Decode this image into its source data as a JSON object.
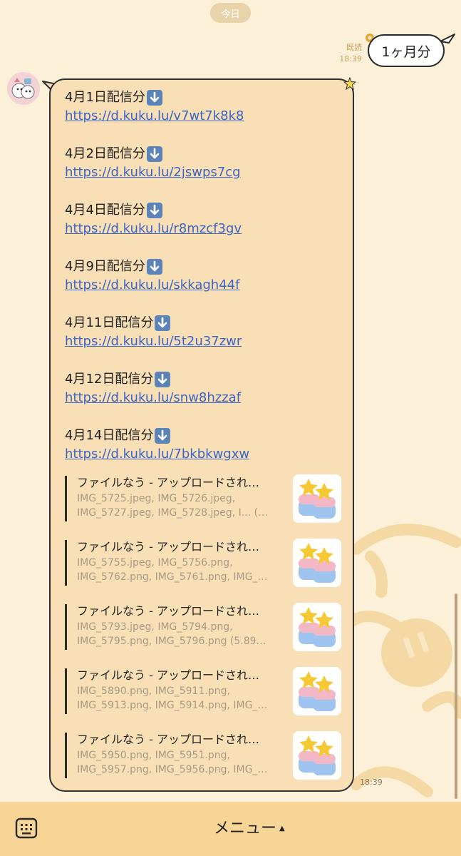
{
  "chat": {
    "date_divider": "今日",
    "outgoing": {
      "text": "1ヶ月分",
      "read_label": "既読",
      "time": "18:39"
    },
    "incoming": {
      "avatar_icon": "avatar-image",
      "time": "18:39",
      "entries": [
        {
          "title": "4月1日配信分",
          "link": "https://d.kuku.lu/v7wt7k8k8"
        },
        {
          "title": "4月2日配信分",
          "link": "https://d.kuku.lu/2jswps7cg"
        },
        {
          "title": "4月4日配信分",
          "link": "https://d.kuku.lu/r8mzcf3gv"
        },
        {
          "title": "4月9日配信分",
          "link": "https://d.kuku.lu/skkagh44f"
        },
        {
          "title": "4月11日配信分",
          "link": "https://d.kuku.lu/5t2u37zwr"
        },
        {
          "title": "4月12日配信分",
          "link": "https://d.kuku.lu/snw8hzzaf"
        },
        {
          "title": "4月14日配信分",
          "link": "https://d.kuku.lu/7bkbkwgxw"
        }
      ],
      "previews": [
        {
          "title": "ファイルなう - アップロードされ…",
          "line1": "IMG_5725.jpeg, IMG_5726.jpeg,",
          "line2": "IMG_5727.jpeg, IMG_5728.jpeg, I... (…"
        },
        {
          "title": "ファイルなう - アップロードされ…",
          "line1": "IMG_5755.jpeg, IMG_5756.png,",
          "line2": "IMG_5762.png, IMG_5761.png, IMG_…"
        },
        {
          "title": "ファイルなう - アップロードされ…",
          "line1": "IMG_5793.jpeg, IMG_5794.png,",
          "line2": "IMG_5795.png, IMG_5796.png (5.89…"
        },
        {
          "title": "ファイルなう - アップロードされ…",
          "line1": "IMG_5890.png, IMG_5911.png,",
          "line2": "IMG_5913.png, IMG_5914.png, IMG_…"
        },
        {
          "title": "ファイルなう - アップロードされ…",
          "line1": "IMG_5950.png, IMG_5951.png,",
          "line2": "IMG_5957.png, IMG_5956.png, IMG_…"
        }
      ]
    }
  },
  "menu": {
    "label": "メニュー",
    "caret": "▲",
    "keyboard_icon": "keyboard-icon"
  },
  "colors": {
    "background": "#fdf0d8",
    "incoming_bubble": "#f9dfb5",
    "link": "#3c64c4",
    "menu_bar": "#f7d596"
  }
}
